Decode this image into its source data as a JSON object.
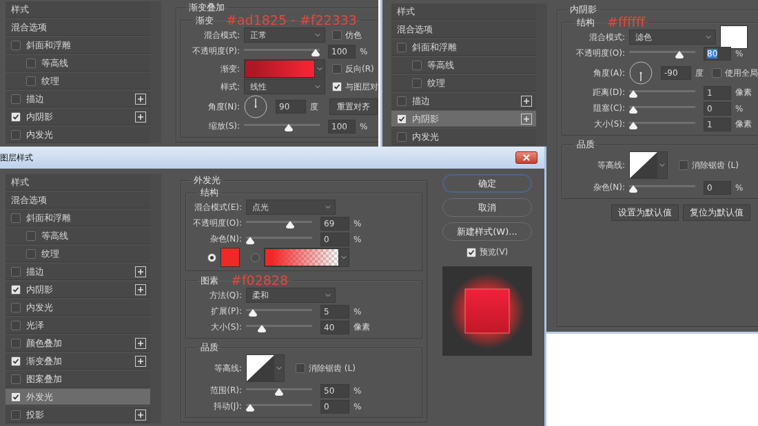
{
  "gradient_overlay_window": {
    "style_list": [
      {
        "label": "样式",
        "kind": "plain",
        "selected": false
      },
      {
        "label": "混合选项",
        "kind": "plain",
        "selected": false
      },
      {
        "label": "斜面和浮雕",
        "kind": "check",
        "checked": false,
        "add": false,
        "selected": false,
        "children": [
          {
            "label": "等高线",
            "kind": "check",
            "checked": false,
            "add": false,
            "selected": false
          },
          {
            "label": "纹理",
            "kind": "check",
            "checked": false,
            "add": false,
            "selected": false
          }
        ]
      },
      {
        "label": "描边",
        "kind": "check",
        "checked": false,
        "add": true,
        "selected": false
      },
      {
        "label": "内阴影",
        "kind": "check",
        "checked": true,
        "add": true,
        "selected": false
      },
      {
        "label": "内发光",
        "kind": "check",
        "checked": false,
        "add": false,
        "selected": false
      }
    ],
    "section": {
      "title": "渐变叠加",
      "groups": [
        {
          "title": "渐变",
          "annotation": "#ad1825 - #f22333",
          "rows": [
            {
              "kind": "select",
              "label": "混合模式:",
              "value": "正常",
              "side": {
                "kind": "checkbox",
                "label": "仿色",
                "checked": false
              }
            },
            {
              "kind": "slider",
              "label": "不透明度(P):",
              "level": 1,
              "value": "100",
              "unit": "%"
            },
            {
              "kind": "gradient",
              "label": "渐变:",
              "stops": [
                {
                  "color": "#ad1825"
                },
                {
                  "color": "#f22333"
                }
              ],
              "side": {
                "kind": "checkbox",
                "label": "反向(R)",
                "checked": false
              }
            },
            {
              "kind": "select",
              "label": "样式:",
              "value": "线性",
              "side": {
                "kind": "checkbox",
                "label": "与图层对",
                "checked": true
              }
            },
            {
              "kind": "angle",
              "label": "角度(N):",
              "pointing_down": false,
              "value": "90",
              "unit": "度",
              "side": {
                "kind": "button",
                "label": "重置对齐"
              }
            },
            {
              "kind": "slider",
              "label": "缩放(S):",
              "level": 0.6,
              "value": "100",
              "unit": "%"
            }
          ]
        }
      ]
    }
  },
  "inner_shadow_window": {
    "style_list": [
      {
        "label": "样式",
        "kind": "plain",
        "selected": false
      },
      {
        "label": "混合选项",
        "kind": "plain",
        "selected": false
      },
      {
        "label": "斜面和浮雕",
        "kind": "check",
        "checked": false,
        "add": false,
        "selected": false,
        "children": [
          {
            "label": "等高线",
            "kind": "check",
            "checked": false,
            "add": false,
            "selected": false
          },
          {
            "label": "纹理",
            "kind": "check",
            "checked": false,
            "add": false,
            "selected": false
          }
        ]
      },
      {
        "label": "描边",
        "kind": "check",
        "checked": false,
        "add": true,
        "selected": false
      },
      {
        "label": "内阴影",
        "kind": "check",
        "checked": true,
        "add": true,
        "selected": true
      },
      {
        "label": "内发光",
        "kind": "check",
        "checked": false,
        "add": false,
        "selected": false
      }
    ],
    "section": {
      "title": "内阴影",
      "groups": [
        {
          "title": "结构",
          "annotation": "#ffffff",
          "rows": [
            {
              "kind": "select",
              "label": "混合模式:",
              "value": "滤色",
              "side": {
                "kind": "swatch",
                "color": "#ffffff"
              }
            },
            {
              "kind": "slider",
              "label": "不透明度(O):",
              "level": 0.8,
              "value": "80",
              "unit": "%",
              "value_selected": true
            },
            {
              "kind": "angle",
              "label": "角度(A):",
              "pointing_down": true,
              "value": "-90",
              "unit": "度",
              "side": {
                "kind": "checkbox",
                "label": "使用全局",
                "checked": false
              }
            },
            {
              "kind": "slider",
              "label": "距离(D):",
              "level": 0,
              "value": "1",
              "unit": "像素"
            },
            {
              "kind": "slider",
              "label": "阻塞(C):",
              "level": 0,
              "value": "0",
              "unit": "%"
            },
            {
              "kind": "slider",
              "label": "大小(S):",
              "level": 0,
              "value": "1",
              "unit": "像素"
            }
          ]
        },
        {
          "title": "品质",
          "rows": [
            {
              "kind": "contour",
              "label": "等高线:",
              "side": {
                "kind": "checkbox",
                "label": "消除锯齿 (L)",
                "checked": false
              }
            },
            {
              "kind": "slider",
              "label": "杂色(N):",
              "level": 0,
              "value": "0",
              "unit": "%"
            }
          ]
        }
      ]
    },
    "buttons": [
      "设置为默认值",
      "复位为默认值"
    ]
  },
  "layer_style_dialog": {
    "title": "图层样式",
    "style_list": [
      {
        "label": "样式",
        "kind": "plain",
        "selected": false
      },
      {
        "label": "混合选项",
        "kind": "plain",
        "selected": false
      },
      {
        "label": "斜面和浮雕",
        "kind": "check",
        "checked": false,
        "add": false,
        "selected": false,
        "children": [
          {
            "label": "等高线",
            "kind": "check",
            "checked": false,
            "add": false,
            "selected": false
          },
          {
            "label": "纹理",
            "kind": "check",
            "checked": false,
            "add": false,
            "selected": false
          }
        ]
      },
      {
        "label": "描边",
        "kind": "check",
        "checked": false,
        "add": true,
        "selected": false
      },
      {
        "label": "内阴影",
        "kind": "check",
        "checked": true,
        "add": true,
        "selected": false
      },
      {
        "label": "内发光",
        "kind": "check",
        "checked": false,
        "add": false,
        "selected": false
      },
      {
        "label": "光泽",
        "kind": "check",
        "checked": false,
        "add": false,
        "selected": false
      },
      {
        "label": "颜色叠加",
        "kind": "check",
        "checked": false,
        "add": true,
        "selected": false
      },
      {
        "label": "渐变叠加",
        "kind": "check",
        "checked": true,
        "add": true,
        "selected": false
      },
      {
        "label": "图案叠加",
        "kind": "check",
        "checked": false,
        "add": false,
        "selected": false
      },
      {
        "label": "外发光",
        "kind": "check",
        "checked": true,
        "add": false,
        "selected": true
      },
      {
        "label": "投影",
        "kind": "check",
        "checked": false,
        "add": true,
        "selected": false
      }
    ],
    "section": {
      "title": "外发光",
      "groups": [
        {
          "title": "结构",
          "rows": [
            {
              "kind": "select",
              "label": "混合模式(E):",
              "value": "点光"
            },
            {
              "kind": "slider",
              "label": "不透明度(O):",
              "level": 0.69,
              "value": "69",
              "unit": "%"
            },
            {
              "kind": "slider",
              "label": "杂色(N):",
              "level": 0,
              "value": "0",
              "unit": "%"
            },
            {
              "kind": "color_choice",
              "options": [
                {
                  "kind": "solid",
                  "color": "#f02828",
                  "selected": true
                },
                {
                  "kind": "gradient",
                  "color": "#f02828",
                  "selected": false
                }
              ]
            }
          ]
        },
        {
          "title": "图素",
          "annotation": "#f02828",
          "rows": [
            {
              "kind": "select",
              "label": "方法(Q):",
              "value": "柔和"
            },
            {
              "kind": "slider",
              "label": "扩展(P):",
              "level": 0.05,
              "value": "5",
              "unit": "%"
            },
            {
              "kind": "slider",
              "label": "大小(S):",
              "level": 0.2,
              "value": "40",
              "unit": "像素"
            }
          ]
        },
        {
          "title": "品质",
          "rows": [
            {
              "kind": "contour",
              "label": "等高线:",
              "side": {
                "kind": "checkbox",
                "label": "消除锯齿 (L)",
                "checked": false
              }
            },
            {
              "kind": "slider",
              "label": "范围(R):",
              "level": 0.5,
              "value": "50",
              "unit": "%"
            },
            {
              "kind": "slider",
              "label": "抖动(J):",
              "level": 0,
              "value": "0",
              "unit": "%"
            }
          ]
        }
      ]
    },
    "actions": [
      {
        "label": "确定",
        "default": true
      },
      {
        "label": "取消",
        "default": false
      },
      {
        "label": "新建样式(W)...",
        "default": false
      }
    ],
    "preview": {
      "label": "预览(V)",
      "checked": true
    }
  }
}
